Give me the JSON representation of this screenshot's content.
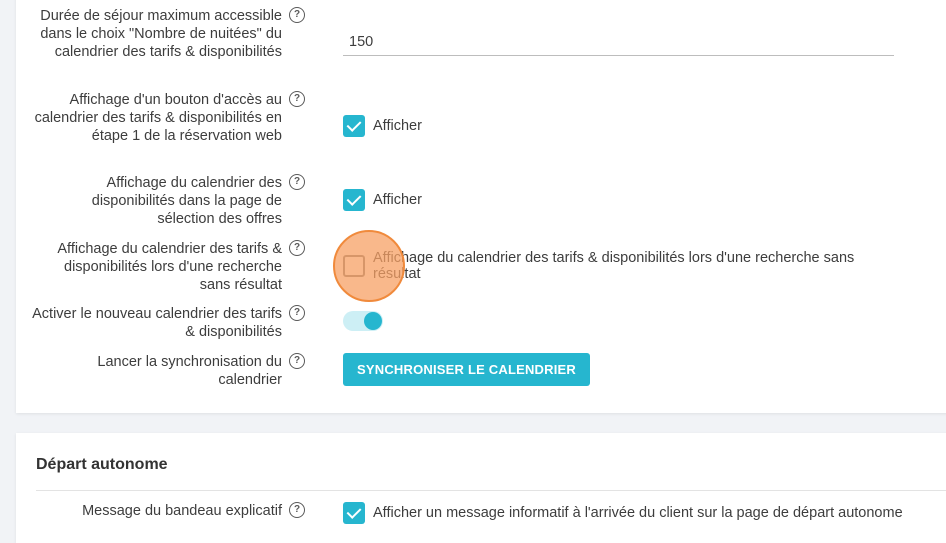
{
  "settings": {
    "max_stay": {
      "label": "Durée de séjour maximum accessible dans le choix \"Nombre de nuitées\" du calendrier des tarifs & disponibilités",
      "value": "150"
    },
    "access_button": {
      "label": "Affichage d'un bouton d'accès au calendrier des tarifs & disponibilités en étape 1 de la réservation web",
      "checkbox_label": "Afficher",
      "checked": true
    },
    "availability_calendar": {
      "label": "Affichage du calendrier des disponibilités dans la page de sélection des offres",
      "checkbox_label": "Afficher",
      "checked": true
    },
    "no_result_calendar": {
      "label": "Affichage du calendrier des tarifs & disponibilités lors d'une recherche sans résultat",
      "checkbox_label": "Affichage du calendrier des tarifs & disponibilités lors d'une recherche sans résultat",
      "checked": false
    },
    "new_calendar": {
      "label": "Activer le nouveau calendrier des tarifs & disponibilités",
      "enabled": true
    },
    "sync": {
      "label": "Lancer la synchronisation du calendrier",
      "button_label": "SYNCHRONISER LE CALENDRIER"
    }
  },
  "depart_autonome": {
    "title": "Départ autonome",
    "banner_message": {
      "label": "Message du bandeau explicatif",
      "checkbox_label": "Afficher un message informatif à l'arrivée du client sur la page de départ autonome",
      "checked": true
    }
  },
  "help_glyph": "?",
  "colors": {
    "accent": "#26b6cf",
    "toggle_track": "#cdeff5",
    "click_indicator": "#f7a064"
  }
}
